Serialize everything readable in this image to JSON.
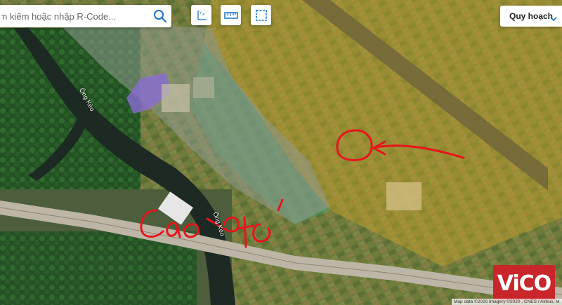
{
  "search": {
    "placeholder": "Tìm kiếm hoặc nhập R-Code..."
  },
  "toolbar": {
    "items": [
      {
        "name": "coordinates-tool",
        "icon": "axis-coordinates-icon"
      },
      {
        "name": "ruler-tool",
        "icon": "ruler-icon"
      },
      {
        "name": "area-tool",
        "icon": "dashed-square-icon"
      }
    ]
  },
  "layer_select": {
    "selected": "Quy hoạch",
    "icon": "chevron-down-icon"
  },
  "map": {
    "river_labels": [
      "Ông Kèo",
      "Ông Kèo"
    ],
    "handwritten_annotation": "Cao tốc",
    "annotation_color": "#e8141b",
    "overlay_colors": {
      "agricultural_zone": "#c9a22a",
      "green_zone": "#3f9e6e",
      "gray_zone": "#8f9a8f",
      "purple_zone": "#8a6bd4"
    }
  },
  "logo": {
    "text": "ViCO",
    "brand_color": "#c9262b"
  },
  "attribution": "Map data ©2020 Imagery ©2020 , CNES / Airbus, M"
}
